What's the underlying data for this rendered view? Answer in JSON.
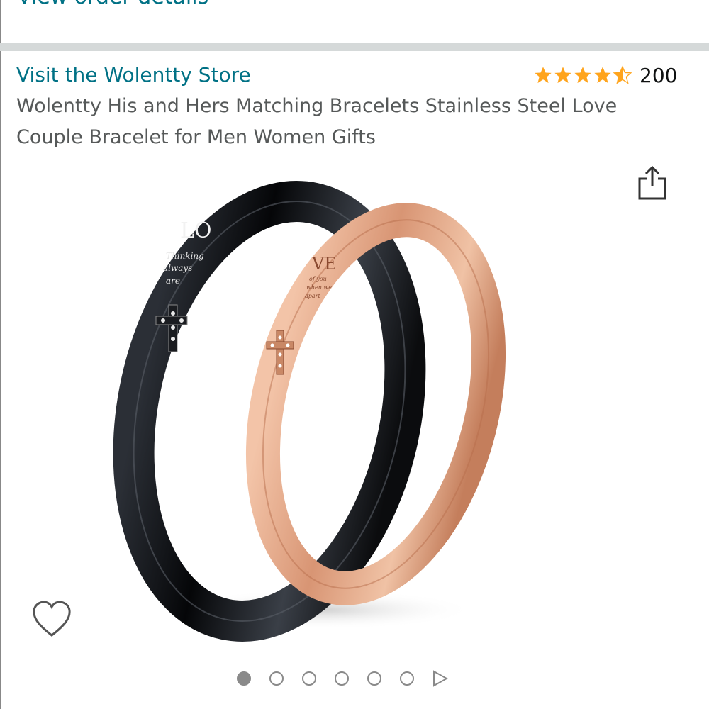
{
  "header": {
    "order_link": "View order details"
  },
  "product": {
    "store_link": "Visit the Wolentty Store",
    "rating": {
      "stars": 4.5,
      "count": "200",
      "star_color": "#ffa41c"
    },
    "title": "Wolentty His and Hers Matching Bracelets Stainless Steel Love Couple Bracelet for Men Women Gifts"
  },
  "gallery": {
    "image_count": 6,
    "active_index": 0,
    "engravings": {
      "black": {
        "big": "LO",
        "small": [
          "Thinking",
          "always",
          "are"
        ]
      },
      "rose": {
        "big": "VE",
        "small": [
          "of you",
          "when we",
          "apart"
        ]
      }
    }
  },
  "icons": [
    "share-icon",
    "heart-icon",
    "play-next-icon",
    "star-icon"
  ],
  "colors": {
    "link": "#007185",
    "text": "#565959",
    "divider": "#d5d9d9"
  }
}
